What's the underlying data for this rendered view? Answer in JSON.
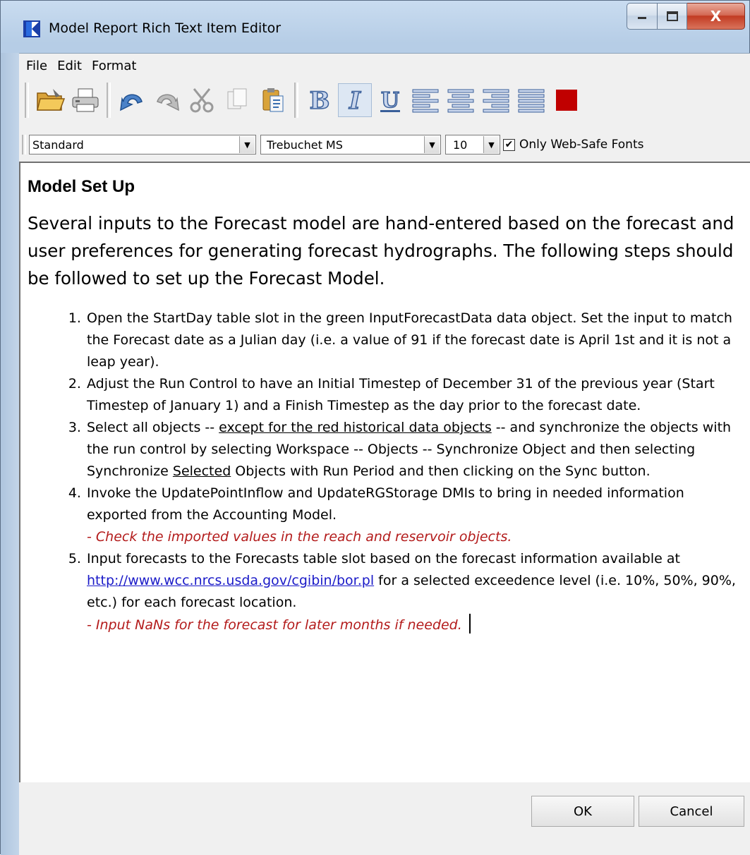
{
  "window": {
    "title": "Model Report Rich Text Item Editor",
    "controls": {
      "minimize": "minimize",
      "maximize": "maximize",
      "close": "X"
    }
  },
  "menu": {
    "items": [
      "File",
      "Edit",
      "Format"
    ]
  },
  "toolbar": {
    "icons": [
      "open-folder-icon",
      "print-icon",
      "undo-icon",
      "redo-icon",
      "cut-icon",
      "copy-icon",
      "paste-icon",
      "bold-icon",
      "italic-icon",
      "underline-icon",
      "align-left-icon",
      "align-center-icon",
      "align-right-icon",
      "justify-icon",
      "text-color-icon"
    ],
    "active": "italic-icon",
    "text_color": "#c00000"
  },
  "format_bar": {
    "style": "Standard",
    "font": "Trebuchet MS",
    "size": "10",
    "web_safe_checked": true,
    "web_safe_label": "Only Web-Safe Fonts"
  },
  "document": {
    "heading": "Model Set Up",
    "intro": "Several inputs to the Forecast model are hand-entered based on the forecast and user preferences for generating forecast hydrographs. The following steps should be followed to set up the Forecast Model.",
    "steps": [
      {
        "text": "Open the StartDay table slot in the green InputForecastData data object. Set the input to match the Forecast date as a Julian day (i.e. a value of 91 if the forecast date is April 1st and it is not a leap year)."
      },
      {
        "text": "Adjust the Run Control to have an Initial Timestep of December 31 of the previous year (Start Timestep of January 1) and a Finish Timestep as the day prior to the forecast date."
      },
      {
        "part1": "Select all objects -- ",
        "underline1": "except for the red historical data objects",
        "part2": " -- and synchronize the objects with the run control by selecting Workspace -- Objects -- Synchronize Object and then selecting Synchronize ",
        "underline2": "Selected",
        "part3": " Objects with Run Period and then clicking on the Sync button."
      },
      {
        "text": "Invoke the UpdatePointInflow and UpdateRGStorage DMIs to bring in needed information exported from the Accounting Model.",
        "note": "- Check the imported values in the reach and reservoir objects."
      },
      {
        "part1": "Input forecasts to the Forecasts table slot based on the forecast information available at ",
        "link": "http://www.wcc.nrcs.usda.gov/cgibin/bor.pl",
        "part2": " for a selected exceedence level (i.e. 10%, 50%, 90%, etc.) for each forecast location.",
        "note": "- Input NaNs for the forecast for later months if needed."
      }
    ],
    "note_color": "#b31b1b",
    "link_color": "#1a1ac8"
  },
  "buttons": {
    "ok": "OK",
    "cancel": "Cancel"
  }
}
